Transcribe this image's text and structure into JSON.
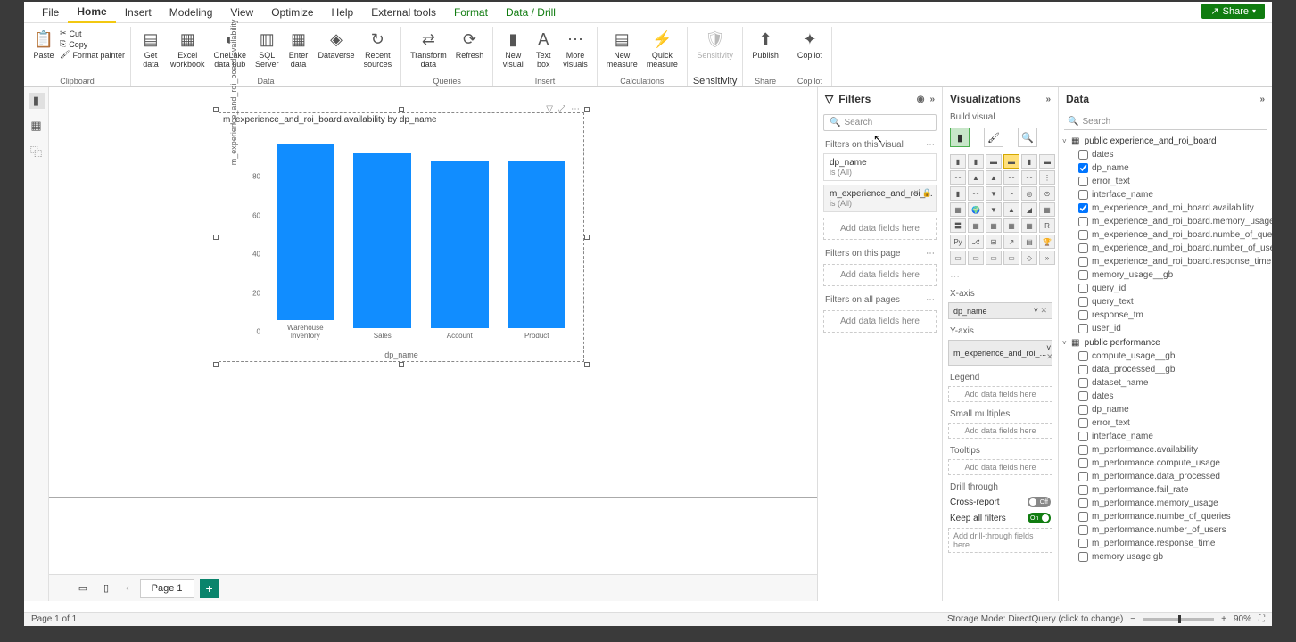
{
  "menubar": {
    "file": "File",
    "home": "Home",
    "insert": "Insert",
    "modeling": "Modeling",
    "view": "View",
    "optimize": "Optimize",
    "help": "Help",
    "external": "External tools",
    "format": "Format",
    "drill": "Data / Drill"
  },
  "share": "Share",
  "ribbon": {
    "clipboard": {
      "paste": "Paste",
      "cut": "Cut",
      "copy": "Copy",
      "painter": "Format painter",
      "label": "Clipboard"
    },
    "data": {
      "get": "Get\ndata",
      "excel": "Excel\nworkbook",
      "onelake": "OneLake\ndata hub",
      "sql": "SQL\nServer",
      "enter": "Enter\ndata",
      "dataverse": "Dataverse",
      "recent": "Recent\nsources",
      "label": "Data"
    },
    "queries": {
      "transform": "Transform\ndata",
      "refresh": "Refresh",
      "label": "Queries"
    },
    "insert": {
      "visual": "New\nvisual",
      "textbox": "Text\nbox",
      "more": "More\nvisuals",
      "label": "Insert"
    },
    "calc": {
      "measure": "New\nmeasure",
      "quick": "Quick\nmeasure",
      "label": "Calculations"
    },
    "sens": {
      "sens": "Sensitivity",
      "label": "Sensitivity"
    },
    "share_g": {
      "publish": "Publish",
      "label": "Share"
    },
    "copilot": {
      "copilot": "Copilot",
      "label": "Copilot"
    }
  },
  "chart_data": {
    "type": "bar",
    "title": "m_experience_and_roi_board.availability by dp_name",
    "xlabel": "dp_name",
    "ylabel": "m_experience_and_roi_board.availability",
    "categories": [
      "Warehouse Inventory",
      "Sales",
      "Account",
      "Product"
    ],
    "values": [
      91,
      90,
      86,
      86
    ],
    "yticks": [
      0,
      20,
      40,
      60,
      80
    ],
    "ylim": [
      0,
      92
    ]
  },
  "page_tabs": {
    "page1": "Page 1"
  },
  "filters": {
    "title": "Filters",
    "search": "Search",
    "visual_label": "Filters on this visual",
    "f1_name": "dp_name",
    "f1_val": "is (All)",
    "f2_name": "m_experience_and_roi_...",
    "f2_val": "is (All)",
    "page_label": "Filters on this page",
    "all_label": "Filters on all pages",
    "add": "Add data fields here"
  },
  "viz": {
    "title": "Visualizations",
    "sub": "Build visual",
    "xaxis": "X-axis",
    "xfield": "dp_name",
    "yaxis": "Y-axis",
    "yfield": "m_experience_and_roi_...",
    "legend": "Legend",
    "small": "Small multiples",
    "tooltips": "Tooltips",
    "add": "Add data fields here",
    "drill": "Drill through",
    "cross": "Cross-report",
    "keep": "Keep all filters",
    "offlabel": "Off",
    "onlabel": "On",
    "adddrill": "Add drill-through fields here"
  },
  "data_panel": {
    "title": "Data",
    "search": "Search",
    "table1": "public experience_and_roi_board",
    "t1_fields": [
      {
        "n": "dates",
        "c": false
      },
      {
        "n": "dp_name",
        "c": true
      },
      {
        "n": "error_text",
        "c": false
      },
      {
        "n": "interface_name",
        "c": false
      },
      {
        "n": "m_experience_and_roi_board.availability",
        "c": true
      },
      {
        "n": "m_experience_and_roi_board.memory_usage",
        "c": false
      },
      {
        "n": "m_experience_and_roi_board.numbe_of_queri...",
        "c": false
      },
      {
        "n": "m_experience_and_roi_board.number_of_users",
        "c": false
      },
      {
        "n": "m_experience_and_roi_board.response_time",
        "c": false
      },
      {
        "n": "memory_usage__gb",
        "c": false
      },
      {
        "n": "query_id",
        "c": false
      },
      {
        "n": "query_text",
        "c": false
      },
      {
        "n": "response_tm",
        "c": false
      },
      {
        "n": "user_id",
        "c": false
      }
    ],
    "table2": "public performance",
    "t2_fields": [
      {
        "n": "compute_usage__gb",
        "c": false
      },
      {
        "n": "data_processed__gb",
        "c": false
      },
      {
        "n": "dataset_name",
        "c": false
      },
      {
        "n": "dates",
        "c": false
      },
      {
        "n": "dp_name",
        "c": false
      },
      {
        "n": "error_text",
        "c": false
      },
      {
        "n": "interface_name",
        "c": false
      },
      {
        "n": "m_performance.availability",
        "c": false
      },
      {
        "n": "m_performance.compute_usage",
        "c": false
      },
      {
        "n": "m_performance.data_processed",
        "c": false
      },
      {
        "n": "m_performance.fail_rate",
        "c": false
      },
      {
        "n": "m_performance.memory_usage",
        "c": false
      },
      {
        "n": "m_performance.numbe_of_queries",
        "c": false
      },
      {
        "n": "m_performance.number_of_users",
        "c": false
      },
      {
        "n": "m_performance.response_time",
        "c": false
      },
      {
        "n": "memory usage  gb",
        "c": false
      }
    ]
  },
  "status": {
    "left": "Page 1 of 1",
    "storage": "Storage Mode: DirectQuery (click to change)",
    "zoom": "90%"
  }
}
